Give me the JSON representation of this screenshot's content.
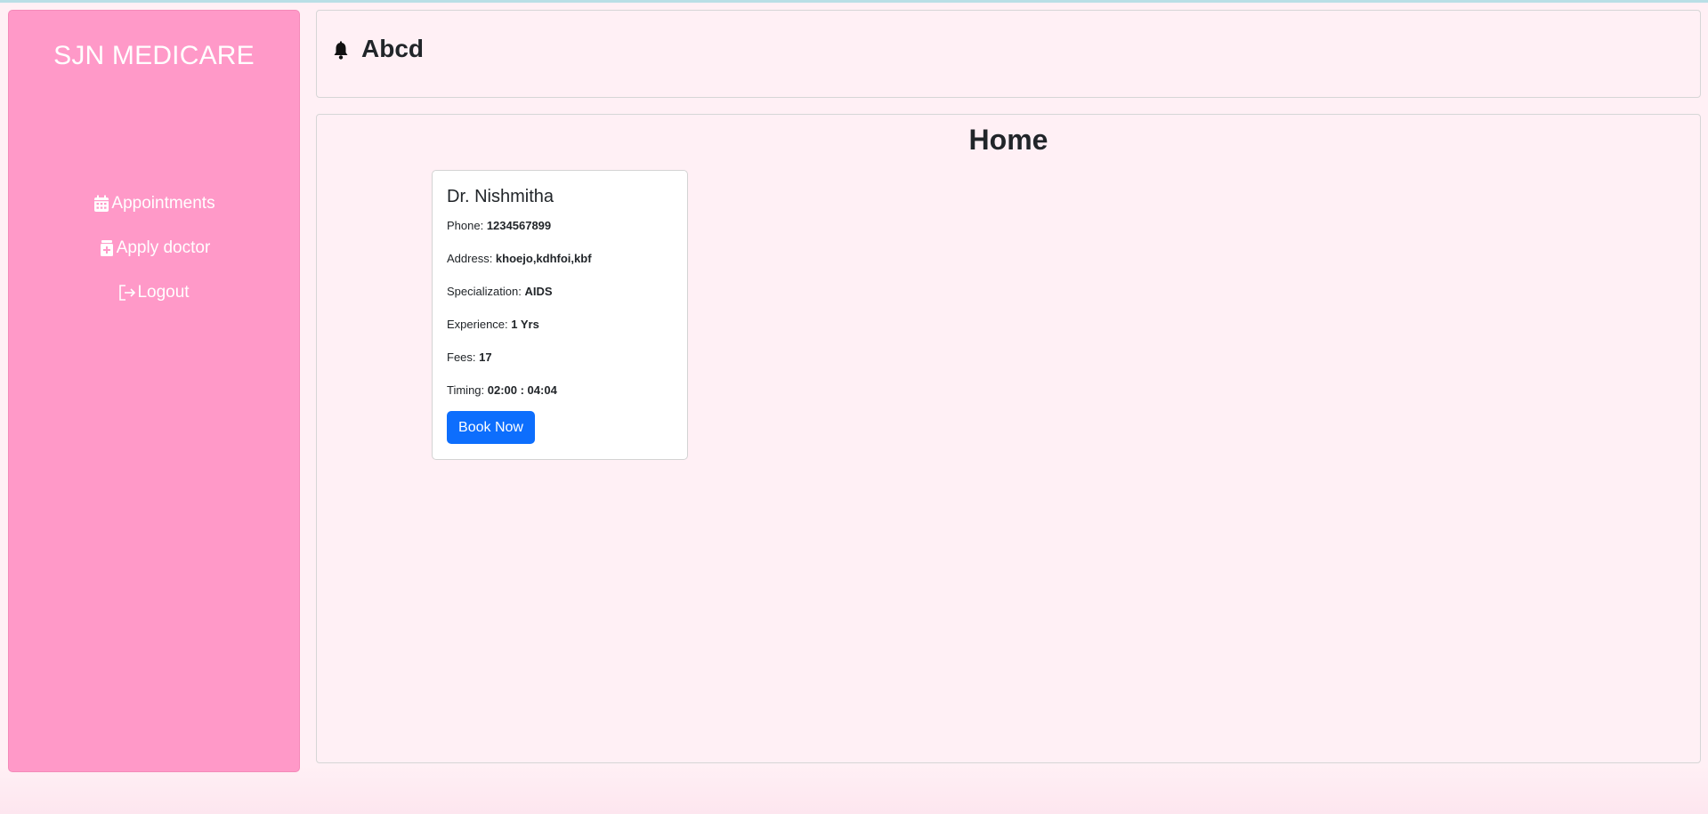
{
  "brand": "SJN MEDICARE",
  "sidebar": {
    "items": [
      {
        "icon": "calendar-icon",
        "label": "Appointments"
      },
      {
        "icon": "medical-file-icon",
        "label": "Apply doctor"
      },
      {
        "icon": "logout-icon",
        "label": "Logout"
      }
    ]
  },
  "header": {
    "icon": "bell-icon",
    "user_name": "Abcd"
  },
  "main": {
    "title": "Home",
    "doctor": {
      "name": "Dr. Nishmitha",
      "phone_label": "Phone: ",
      "phone": "1234567899",
      "address_label": "Address: ",
      "address": "khoejo,kdhfoi,kbf",
      "specialization_label": "Specialization: ",
      "specialization": "AIDS",
      "experience_label": "Experience: ",
      "experience": "1 Yrs",
      "fees_label": "Fees: ",
      "fees": "17",
      "timing_label": "Timing: ",
      "timing": "02:00 : 04:04",
      "book_label": "Book Now"
    }
  },
  "colors": {
    "sidebar_bg": "#ff99c8",
    "page_bg": "#fff0f5",
    "button_bg": "#0d6efd"
  }
}
